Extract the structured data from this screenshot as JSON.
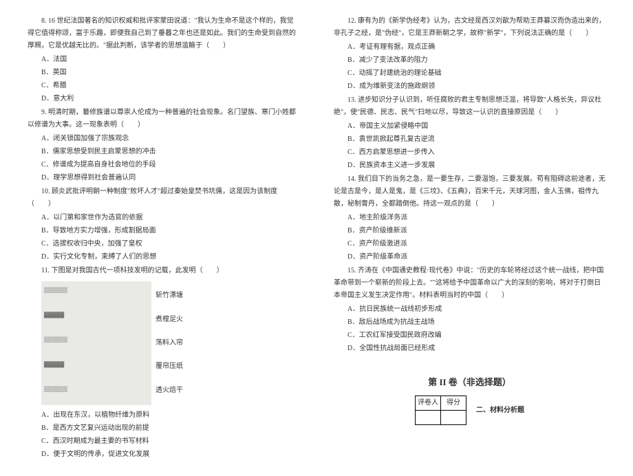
{
  "left": {
    "q8": {
      "stem": "8. 16 世纪法国著名的知识权威和批评家蒙田说道：\"我认为生命不是这个样的，我觉得它值得称颂，富于乐趣，即便我自己到了垂暮之年也还是如此。我们的生命受到自然的厚赐，它是优越无比的。\"据此判断，该学者的思想滥觞于（　　）",
      "A": "A．法国",
      "B": "B．英国",
      "C": "C．希腊",
      "D": "D．意大利"
    },
    "q9": {
      "stem": "9. 明清时期，纂修族谱以尊崇人伦成为一种普遍的社会现象。名门望族、寒门小姓都以修谱为大事。这一现象表明（　　）",
      "A": "A．闭关锁国加强了宗族观念",
      "B": "B．儒家思想受到民主启蒙思想的冲击",
      "C": "C．修谱成为提高自身社会地位的手段",
      "D": "D．理学思想得到社会普遍认同"
    },
    "q10": {
      "stem": "10. 顾炎武批评明朝一种制度\"败坏人才\"超过秦始皇焚书坑儒，这是因为该制度（　　）",
      "A": "A．以门第和家世作为选官的依据",
      "B": "B．导致地方实力增强，形成割据局面",
      "C": "C．选拔权收归中央，加强了皇权",
      "D": "D．实行文化专制，束缚了人们的思想"
    },
    "q11": {
      "stem": "11. 下图是对我国古代一项科技发明的记载，此发明（　　）",
      "ill": {
        "r1": "斩竹漂塘",
        "r2": "煮楻足火",
        "r3": "荡料入帘",
        "r4": "覆帘压纸",
        "r5": "透火焙干"
      },
      "A": "A．出现在东汉，以植物纤维为原料",
      "B": "B．是西方文艺复兴运动出现的前提",
      "C": "C．西汉时期成为最主要的书写材料",
      "D": "D．便于文明的传承，促进文化发展"
    }
  },
  "right": {
    "q12": {
      "stem": "12. 康有为的《新学伪经考》认为，古文经是西汉刘歆为帮助王莽篡汉而伪造出来的，非孔子之经，是\"伪经\"，它是王莽新朝之学，故称\"新学\"，下列说法正确的是（　　）",
      "A": "A．考证有理有据，观点正确",
      "B": "B．减少了变法改革的阻力",
      "C": "C．动摇了封建统治的理论基础",
      "D": "D．成为维新变法的施政纲领"
    },
    "q13": {
      "stem": "13. 进步知识分子认识到，听任腐败的君主专制思想泛滥，将导致\"人格长失，异议杜绝\"，使\"民德、民志、民气\"扫地以尽，导致这一认识的直接原因是（　　）",
      "A": "A．帝国主义加紧侵略中国",
      "B": "B．袁世凯掀起尊孔复古逆流",
      "C": "C．西方启蒙思想进一步传入",
      "D": "D．民族资本主义进一步发展"
    },
    "q14": {
      "stem": "14. 我们目下的当务之急，是一要生存，二要温饱，三要发展。苟有阻碍这前途者，无论是古是今，是人是鬼，是《三坟》、《五典》，百宋千元，天球河图，金人玉佛，祖传九散，秘制膏丹，全都踏倒他。持这一观点的是（　　）",
      "A": "A．地主阶级洋务派",
      "B": "B．资产阶级维新派",
      "C": "C．资产阶级激进派",
      "D": "D．资产阶级革命派"
    },
    "q15": {
      "stem": "15. 齐涛在《中国通史教程·现代卷》中说：\"历史的车轮将经过这个统一战线，把中国革命带到一个崭新的阶段上去。\"\"这将给予中国革命以广大的深刻的影响，将对于打倒日本帝国主义发生决定作用\"。材料表明当时的中国（　　）",
      "A": "A．抗日民族统一战线初步形成",
      "B": "B．敌后战场成为抗战主战场",
      "C": "C．工农红军接受国民政府改编",
      "D": "D．全国性抗战局面已经形成"
    },
    "section2": "第 II 卷（非选择题）",
    "score_table": {
      "c1": "评卷人",
      "c2": "得分"
    },
    "material_title": "二、材料分析题"
  }
}
